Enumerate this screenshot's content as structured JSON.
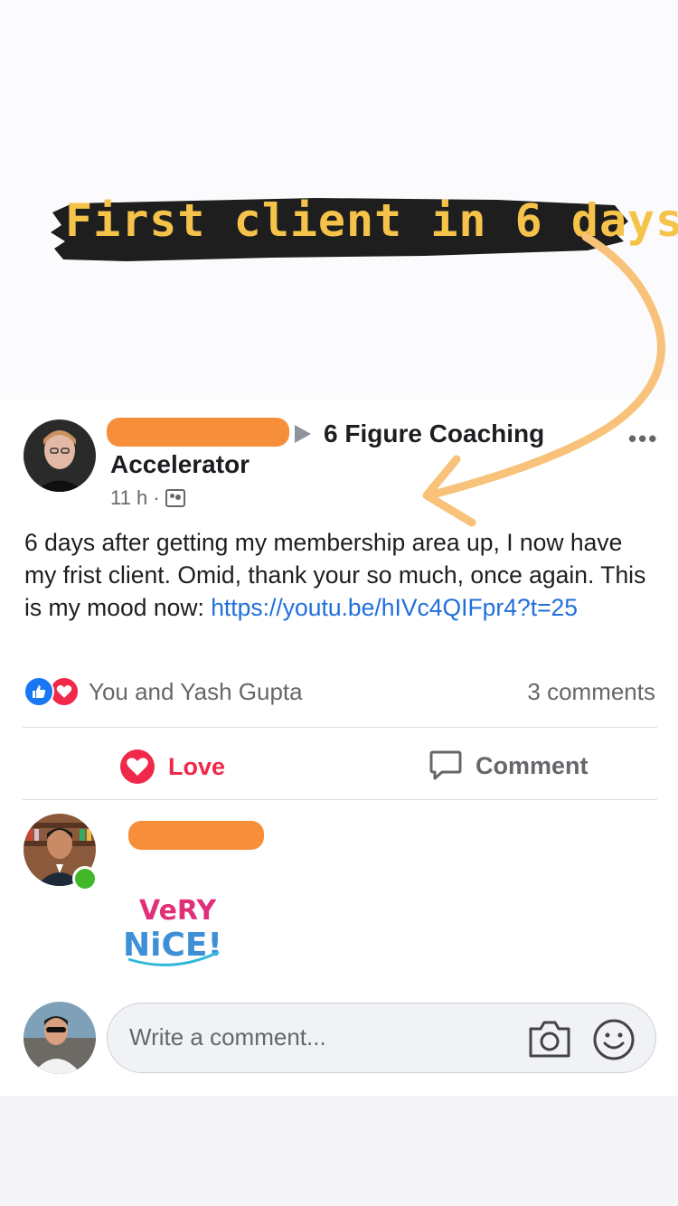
{
  "banner": {
    "text": "First client in 6 days"
  },
  "post": {
    "group_name_line1": "6 Figure Coaching",
    "group_name_line2": "Accelerator",
    "time": "11 h",
    "meta_separator": "·",
    "body_text": "6 days after getting my membership area up, I now have my frist client. Omid, thank your so much, once again. This is my mood now: ",
    "body_link": "https://youtu.be/hIVc4QIFpr4?t=25",
    "more_icon": "•••",
    "reactions_names": "You and Yash Gupta",
    "comments_count": "3 comments"
  },
  "actions": {
    "love_label": "Love",
    "comment_label": "Comment"
  },
  "comment": {
    "sticker_word1": "VeRY",
    "sticker_word2": "NiCE!"
  },
  "composer": {
    "placeholder": "Write a comment..."
  },
  "colors": {
    "banner_text": "#f5c24a",
    "banner_bg": "#1e1e1e",
    "redaction": "#f78f3a",
    "link": "#216fdb",
    "love": "#f0284a",
    "like": "#1877f2",
    "online": "#42b72a",
    "annotation_arrow": "#f8c27a"
  }
}
